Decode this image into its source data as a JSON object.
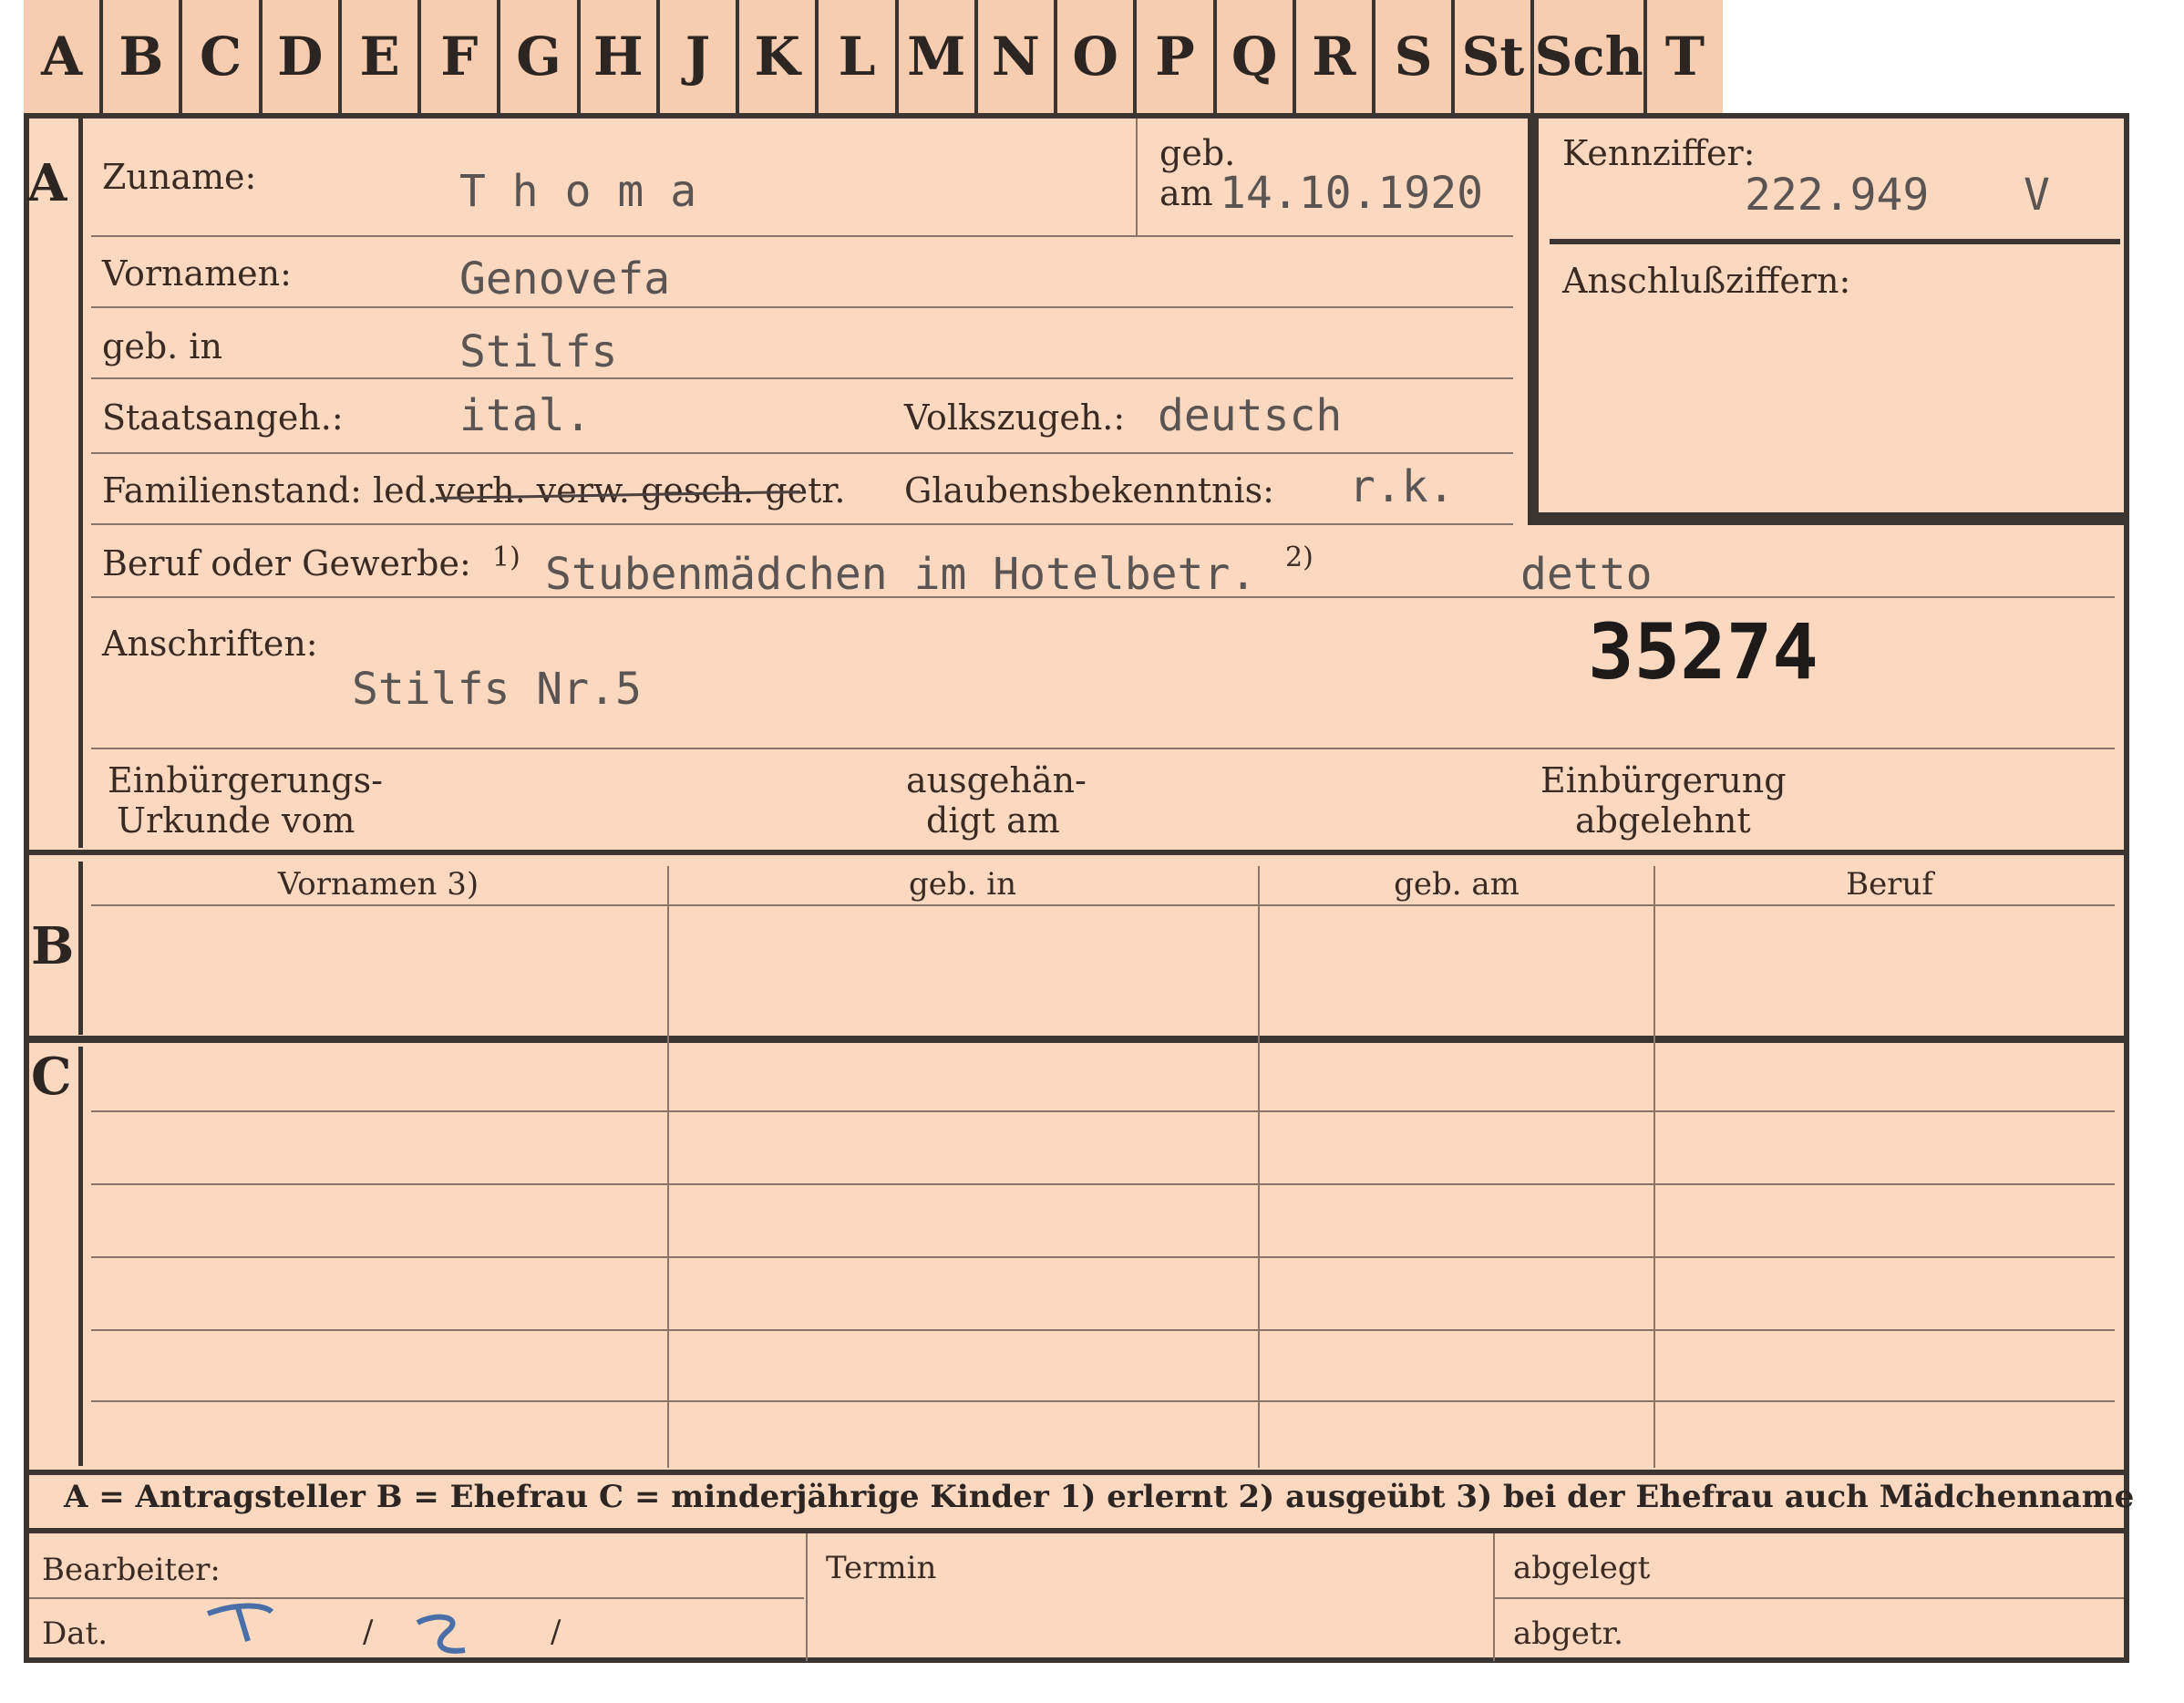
{
  "tabs": [
    "A",
    "B",
    "C",
    "D",
    "E",
    "F",
    "G",
    "H",
    "J",
    "K",
    "L",
    "M",
    "N",
    "O",
    "P",
    "Q",
    "R",
    "S",
    "St",
    "Sch",
    "T"
  ],
  "sections": {
    "a": "A",
    "b": "B",
    "c": "C"
  },
  "labels": {
    "zuname": "Zuname:",
    "geb": "geb.",
    "am": "am",
    "kennziffer": "Kennziffer:",
    "anschluss": "Anschlußziffern:",
    "vornamen": "Vornamen:",
    "geb_in": "geb. in",
    "staatsangeh": "Staatsangeh.:",
    "volkszugeh": "Volkszugeh.:",
    "familienstand": "Familienstand: led.",
    "familienstand_struck": "verh. verw. gesch. getr.",
    "glaubens": "Glaubensbekenntnis:",
    "beruf": "Beruf oder Gewerbe:",
    "fn1": "1)",
    "fn2": "2)",
    "anschriften": "Anschriften:",
    "einb1": "Einbürgerungs-",
    "einb2": "Urkunde vom",
    "ausg1": "ausgehän-",
    "ausg2": "digt am",
    "abgel1": "Einbürgerung",
    "abgel2": "abgelehnt",
    "bearbeiter": "Bearbeiter:",
    "dat": "Dat.",
    "slash1": "/",
    "slash2": "/",
    "termin": "Termin",
    "abgelegt": "abgelegt",
    "abgetr": "abgetr."
  },
  "values": {
    "zuname": "T h o m a",
    "geburtsdatum": "14.10.1920",
    "kennziffer": "222.949",
    "kennziffer_suffix": "V",
    "vornamen": "Genovefa",
    "geburtsort": "Stilfs",
    "staatsangeh": "ital.",
    "volkszugeh": "deutsch",
    "glaubens": "r.k.",
    "beruf_erlernt": "Stubenmädchen im Hotelbetr.",
    "beruf_ausgeuebt": "detto",
    "anschrift": "Stilfs Nr.5",
    "stamp": "35274"
  },
  "table_headers": [
    "Vornamen 3)",
    "geb. in",
    "geb. am",
    "Beruf"
  ],
  "legend": "A = Antragsteller   B = Ehefrau   C = minderjährige Kinder   1) erlernt   2) ausgeübt   3) bei der Ehefrau auch Mädchenname"
}
